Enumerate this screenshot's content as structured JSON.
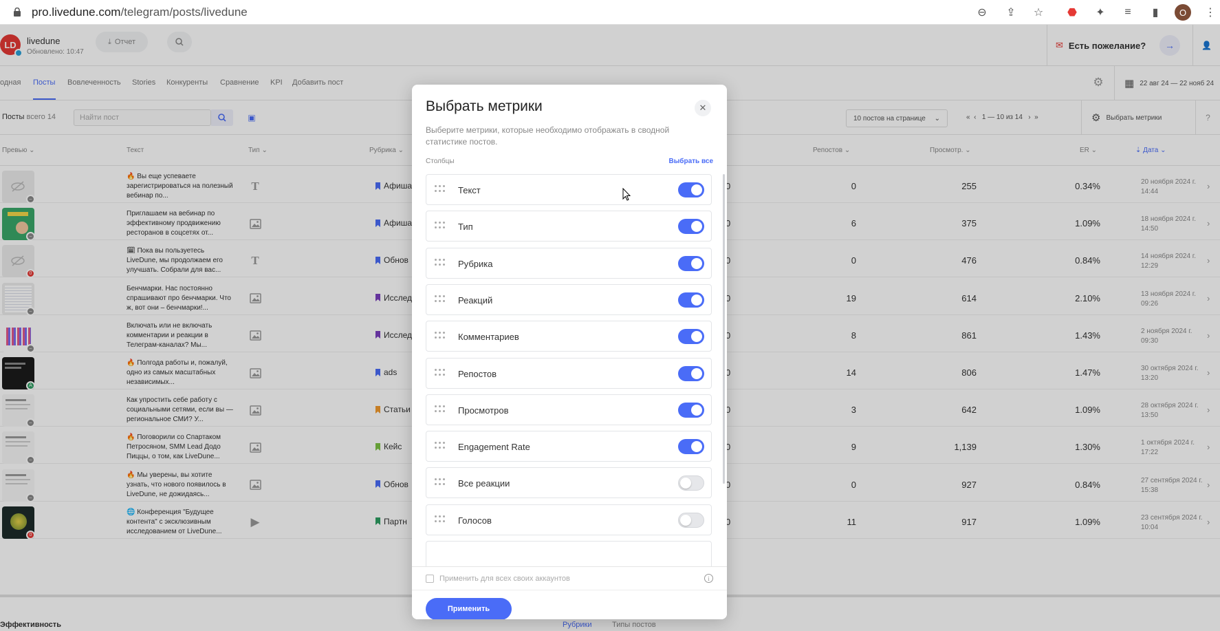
{
  "browser": {
    "url_host": "pro.livedune.com",
    "url_path": "/telegram/posts/livedune",
    "profile_initial": "O"
  },
  "header": {
    "logo_text": "LD",
    "account_name": "livedune",
    "updated": "Обновлено: 10:47",
    "report_label": "Отчет",
    "wish_label": "Есть пожелание?"
  },
  "tabs": [
    {
      "label": "одная"
    },
    {
      "label": "Посты",
      "active": true
    },
    {
      "label": "Вовлеченность"
    },
    {
      "label": "Stories"
    },
    {
      "label": "Конкуренты"
    },
    {
      "label": "Сравнение"
    },
    {
      "label": "KPI"
    },
    {
      "label": "Добавить пост"
    }
  ],
  "date_range": "22 авг 24 — 22 нояб 24",
  "toolbar": {
    "posts_label": "Посты",
    "posts_count": "всего 14",
    "search_placeholder": "Найти пост",
    "per_page": "10 постов на странице",
    "pager_range": "1 — 10 из 14",
    "choose_metrics": "Выбрать метрики"
  },
  "table": {
    "headers": {
      "preview": "Превью",
      "text": "Текст",
      "type": "Тип",
      "rubric": "Рубрика",
      "reposts": "Репостов",
      "views": "Просмотр.",
      "er": "ER",
      "date": "Дата"
    },
    "rows": [
      {
        "text": "🔥 Вы еще успеваете зарегистрироваться на полезный вебинар по...",
        "type": "T",
        "rubric": "Афиша",
        "rubric_color": "#4a6cf7",
        "c0": "0",
        "reposts": "0",
        "views": "255",
        "er": "0.34%",
        "date": "20 ноября 2024 г.",
        "time": "14:44",
        "thumb": "hidden",
        "badge": "–",
        "badge_kind": "grey"
      },
      {
        "text": "Приглашаем на вебинар по эффективному продвижению ресторанов в соцсетях от...",
        "type": "img",
        "rubric": "Афиша",
        "rubric_color": "#4a6cf7",
        "c0": "0",
        "reposts": "6",
        "views": "375",
        "er": "1.09%",
        "date": "18 ноября 2024 г.",
        "time": "14:50",
        "thumb": "green",
        "badge": "–",
        "badge_kind": "grey"
      },
      {
        "text": "🗓 Пока вы пользуетесь LiveDune, мы продолжаем его улучшать. Собрали для вас...",
        "type": "T",
        "rubric": "Обнов",
        "rubric_color": "#4a6cf7",
        "c0": "0",
        "reposts": "0",
        "views": "476",
        "er": "0.84%",
        "date": "14 ноября 2024 г.",
        "time": "12:29",
        "thumb": "hidden",
        "badge": "0",
        "badge_kind": "red"
      },
      {
        "text": "Бенчмарки. Нас постоянно спрашивают про бенчмарки. Что ж, вот они – бенчмарки!...",
        "type": "img",
        "rubric": "Исслед",
        "rubric_color": "#7b3fbf",
        "c0": "0",
        "reposts": "19",
        "views": "614",
        "er": "2.10%",
        "date": "13 ноября 2024 г.",
        "time": "09:26",
        "thumb": "table",
        "badge": "–",
        "badge_kind": "grey"
      },
      {
        "text": "Включать или не включать комментарии и реакции в Телеграм-каналах? Мы...",
        "type": "img",
        "rubric": "Исслед",
        "rubric_color": "#7b3fbf",
        "c0": "0",
        "reposts": "8",
        "views": "861",
        "er": "1.43%",
        "date": "2 ноября 2024 г.",
        "time": "09:30",
        "thumb": "bars",
        "badge": "–",
        "badge_kind": "grey"
      },
      {
        "text": "🔥 Полгода работы и, пожалуй, одно из самых масштабных независимых...",
        "type": "img",
        "rubric": "ads",
        "rubric_color": "#4a6cf7",
        "c0": "0",
        "reposts": "14",
        "views": "806",
        "er": "1.47%",
        "date": "30 октября 2024 г.",
        "time": "13:20",
        "thumb": "dark",
        "badge": "A",
        "badge_kind": "green"
      },
      {
        "text": "Как упростить себе работу с социальными сетями, если вы — региональное СМИ? У...",
        "type": "img",
        "rubric": "Статьи",
        "rubric_color": "#f29a2e",
        "c0": "0",
        "reposts": "3",
        "views": "642",
        "er": "1.09%",
        "date": "28 октября 2024 г.",
        "time": "13:50",
        "thumb": "doc",
        "badge": "–",
        "badge_kind": "grey"
      },
      {
        "text": "🔥 Поговорили со Спартаком Петросяном, SMM Lead Додо Пиццы, о том, как LiveDune...",
        "type": "img",
        "rubric": "Кейс",
        "rubric_color": "#7cc142",
        "c0": "0",
        "reposts": "9",
        "views": "1,139",
        "er": "1.30%",
        "date": "1 октября 2024 г.",
        "time": "17:22",
        "thumb": "doc",
        "badge": "–",
        "badge_kind": "grey"
      },
      {
        "text": "🔥 Мы уверены, вы хотите узнать, что нового появилось в LiveDune, не дожидаясь...",
        "type": "img",
        "rubric": "Обнов",
        "rubric_color": "#4a6cf7",
        "c0": "0",
        "reposts": "0",
        "views": "927",
        "er": "0.84%",
        "date": "27 сентября 2024 г.",
        "time": "15:38",
        "thumb": "doc",
        "badge": "–",
        "badge_kind": "grey"
      },
      {
        "text": "🌐 Конференция \"Будущее контента\" с эксклюзивным исследованием от LiveDune...",
        "type": "play",
        "rubric": "Партн",
        "rubric_color": "#2e9e62",
        "c0": "0",
        "reposts": "11",
        "views": "917",
        "er": "1.09%",
        "date": "23 сентября 2024 г.",
        "time": "10:04",
        "thumb": "globe",
        "badge": "0",
        "badge_kind": "red"
      }
    ]
  },
  "bottom": {
    "efficiency": "Эффективность",
    "rubrics": "Рубрики",
    "post_types": "Типы постов"
  },
  "modal": {
    "title": "Выбрать метрики",
    "description": "Выберите метрики, которые необходимо отображать в сводной статистике постов.",
    "columns_label": "Столбцы",
    "select_all": "Выбрать все",
    "items": [
      {
        "label": "Текст",
        "on": true
      },
      {
        "label": "Тип",
        "on": true
      },
      {
        "label": "Рубрика",
        "on": true
      },
      {
        "label": "Реакций",
        "on": true
      },
      {
        "label": "Комментариев",
        "on": true
      },
      {
        "label": "Репостов",
        "on": true
      },
      {
        "label": "Просмотров",
        "on": true
      },
      {
        "label": "Engagement Rate",
        "on": true
      },
      {
        "label": "Все реакции",
        "on": false
      },
      {
        "label": "Голосов",
        "on": false
      }
    ],
    "apply_all_label": "Применить для всех своих аккаунтов",
    "apply_label": "Применить"
  },
  "colors": {
    "accent": "#4a6cf7",
    "brand_red": "#e53935"
  }
}
